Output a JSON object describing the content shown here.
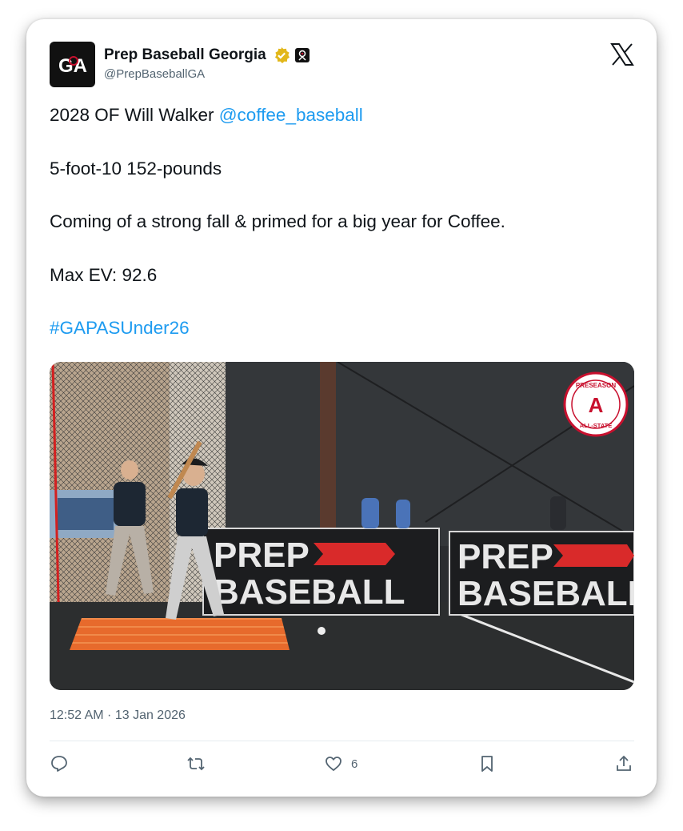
{
  "author": {
    "display_name": "Prep Baseball Georgia",
    "handle": "@PrepBaseballGA",
    "avatar_text": "GA"
  },
  "tweet": {
    "line1_prefix": "2028 OF Will Walker ",
    "line1_mention": "@coffee_baseball",
    "line2": "5-foot-10 152-pounds",
    "line3": "Coming of a strong fall & primed for a big year for Coffee.",
    "line4": "Max EV: 92.6",
    "hashtag": "#GAPASUnder26"
  },
  "media": {
    "banner_word1": "PREP",
    "banner_word2": "BASEBALL",
    "badge_top": "PRESEASON",
    "badge_bottom": "ALL-STATE",
    "badge_center": "A"
  },
  "timestamp": "12:52 AM · 13 Jan 2026",
  "actions": {
    "like_count": "6"
  },
  "colors": {
    "link": "#1d9bf0",
    "text": "#0f1419",
    "muted": "#536471",
    "verified_gold": "#e2b719"
  },
  "icons": [
    "x-logo-icon",
    "verified-badge-icon",
    "affiliate-badge-icon",
    "reply-icon",
    "retweet-icon",
    "like-icon",
    "bookmark-icon",
    "share-icon"
  ]
}
